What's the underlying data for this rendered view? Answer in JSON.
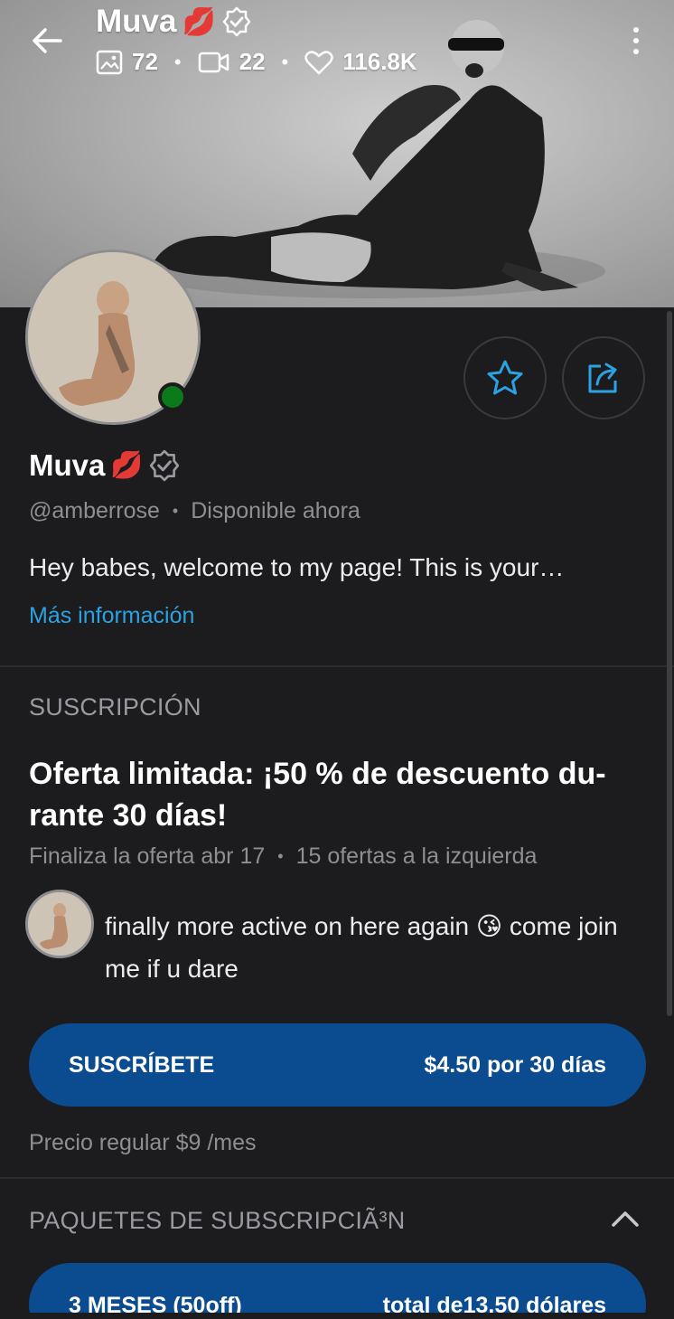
{
  "header": {
    "name": "Muva",
    "emoji": "💋",
    "photos_count": "72",
    "videos_count": "22",
    "likes_count": "116.8K"
  },
  "profile": {
    "name": "Muva",
    "emoji": "💋",
    "username": "@amberrose",
    "status": "Disponible ahora",
    "bio": "Hey babes, welcome to my page! This is your…",
    "more_info": "Más información"
  },
  "subscription": {
    "section_title": "SUSCRIPCIÓN",
    "offer_title": "Oferta limitada: ¡50 % de descuento du-rante 30 días!",
    "offer_ends": "Finaliza la oferta abr 17",
    "offers_left": "15 ofertas a la izquierda",
    "message": "finally more active on here again 😘 come join me if u dare",
    "subscribe_label": "SUSCRÍBETE",
    "subscribe_price": "$4.50 por 30 días",
    "regular_price": "Precio regular $9 /mes"
  },
  "bundles": {
    "section_title": "PAQUETES DE SUBSCRIPCIÃ³N",
    "items": [
      {
        "label": "3 MESES (50off)",
        "price": "total de13.50 dólares"
      }
    ]
  },
  "colors": {
    "background": "#1c1c1e",
    "accent": "#2ba3e3",
    "button": "#0b4b8f",
    "online": "#0b7a1a"
  },
  "icons": {
    "back": "arrow-left-icon",
    "verified": "verified-badge-icon",
    "photo": "image-icon",
    "video": "video-icon",
    "like": "heart-icon",
    "more": "more-vertical-icon",
    "favorite": "star-icon",
    "share": "share-icon",
    "collapse": "chevron-up-icon"
  }
}
